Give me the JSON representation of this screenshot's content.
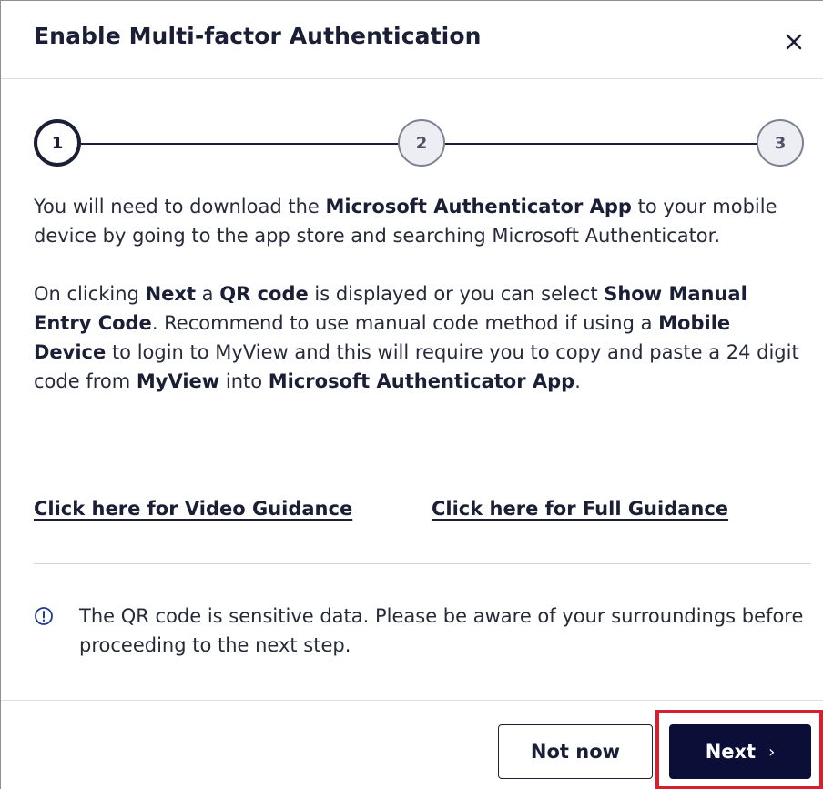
{
  "dialog": {
    "title": "Enable Multi-factor Authentication",
    "close_icon": "close-icon"
  },
  "stepper": {
    "steps": [
      {
        "label": "1",
        "state": "active"
      },
      {
        "label": "2",
        "state": "inactive"
      },
      {
        "label": "3",
        "state": "inactive"
      }
    ]
  },
  "content": {
    "para1": {
      "t1": "You will need to download the ",
      "b1": "Microsoft Authenticator App",
      "t2": " to your mobile device by going to the app store and searching Microsoft Authenticator."
    },
    "para2": {
      "t1": "On clicking ",
      "b1": "Next",
      "t2": " a ",
      "b2": "QR code",
      "t3": " is displayed or you can select ",
      "b3": "Show Manual Entry Code",
      "t4": ". Recommend to use manual code method if using a ",
      "b4": "Mobile Device",
      "t5": " to login to MyView and this will require you to copy and paste a 24 digit code from ",
      "b5": "MyView",
      "t6": " into ",
      "b6": "Microsoft Authenticator App",
      "t7": "."
    }
  },
  "links": {
    "video": "Click here for Video Guidance",
    "full": "Click here for Full Guidance"
  },
  "notice": {
    "icon": "info-icon",
    "text": "The QR code is sensitive data. Please be aware of your surroundings before proceeding to the next step."
  },
  "footer": {
    "not_now": "Not now",
    "next": "Next",
    "next_chevron": "›"
  },
  "colors": {
    "primary": "#0b0f38",
    "highlight": "#d6202f",
    "divider": "#d9dce1"
  }
}
